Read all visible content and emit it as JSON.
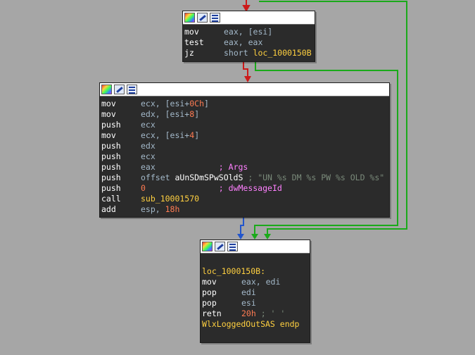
{
  "colors": {
    "background": "#a6a6a6",
    "block_bg": "#2b2b2b",
    "edge_red": "#cc1a1a",
    "edge_green": "#1aaa1a",
    "edge_blue": "#2255cc",
    "mnemonic": "#ffffff",
    "operand": "#a3b8c9",
    "number": "#ff7b52",
    "label": "#ffd040",
    "comment": "#ff80ff"
  },
  "titlebar_icons": [
    "color-palette-icon",
    "edit-pen-icon",
    "graph-view-icon"
  ],
  "block1": {
    "lines": [
      {
        "mn": "mov",
        "op": "eax, [esi]"
      },
      {
        "mn": "test",
        "op": "eax, eax"
      },
      {
        "mn": "jz",
        "op": "short ",
        "target": "loc_1000150B"
      }
    ]
  },
  "block2": {
    "lines": [
      {
        "mn": "mov",
        "op1": "ecx, [esi+",
        "num": "0Ch",
        "op2": "]"
      },
      {
        "mn": "mov",
        "op1": "edx, [esi+",
        "num": "8",
        "op2": "]"
      },
      {
        "mn": "push",
        "op": "ecx"
      },
      {
        "mn": "mov",
        "op1": "ecx, [esi+",
        "num": "4",
        "op2": "]"
      },
      {
        "mn": "push",
        "op": "edx"
      },
      {
        "mn": "push",
        "op": "ecx"
      },
      {
        "mn": "push",
        "op": "eax",
        "pad": "             ",
        "comment": "; Args"
      },
      {
        "mn": "push",
        "op": "offset ",
        "name": "aUnSDmSPwSOldS",
        "pad": " ",
        "comment": "; \"UN %s DM %s PW %s OLD %s\""
      },
      {
        "mn": "push",
        "num": "0",
        "pad": "               ",
        "comment": "; dwMessageId"
      },
      {
        "mn": "call",
        "target": "sub_10001570"
      },
      {
        "mn": "add",
        "op": "esp, ",
        "num": "18h"
      }
    ]
  },
  "block3": {
    "label": "loc_1000150B:",
    "lines": [
      {
        "mn": "mov",
        "op": "eax, edi"
      },
      {
        "mn": "pop",
        "op": "edi"
      },
      {
        "mn": "pop",
        "op": "esi"
      },
      {
        "mn": "retn",
        "num": "20h",
        "comment": " ; ' '"
      }
    ],
    "endp": "WlxLoggedOutSAS endp"
  }
}
